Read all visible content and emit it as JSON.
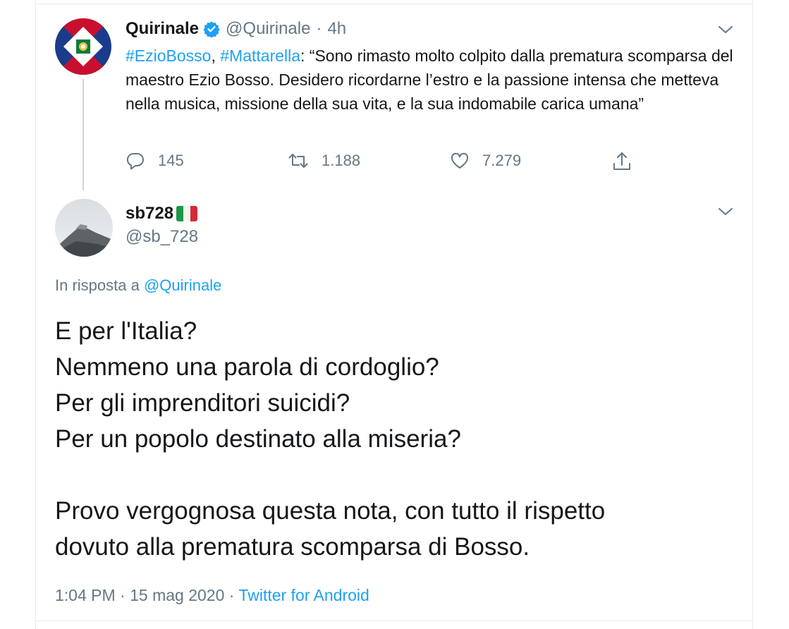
{
  "parent_tweet": {
    "author_name": "Quirinale",
    "handle": "@Quirinale",
    "separator": "·",
    "time": "4h",
    "hashtag_1": "#EzioBosso",
    "comma": ",",
    "hashtag_2": "#Mattarella",
    "text": ": “Sono rimasto molto colpito dalla prematura scomparsa del maestro Ezio Bosso. Desidero ricordarne l’estro e la passione intensa che metteva nella musica, missione della sua vita, e la sua indomabile carica umana”",
    "replies": "145",
    "retweets": "1.188",
    "likes": "7.279",
    "icons": {
      "reply": "reply-icon",
      "retweet": "retweet-icon",
      "like": "heart-icon",
      "share": "share-icon",
      "menu": "chevron-down-icon",
      "verified": "verified-badge-icon"
    }
  },
  "reply_tweet": {
    "author_name": "sb728",
    "flag": "italian-flag-icon",
    "handle": "@sb_728",
    "in_reply_to_prefix": "In risposta a",
    "in_reply_to_handle": "@Quirinale",
    "lines": [
      "E per l'Italia?",
      "Nemmeno una parola di cordoglio?",
      "Per gli imprenditori suicidi?",
      "Per un popolo destinato alla miseria?",
      "",
      "Provo vergognosa questa nota, con tutto il rispetto",
      "dovuto alla prematura scomparsa di Bosso."
    ],
    "time": "1:04 PM",
    "meta_sep": "·",
    "date": "15 mag 2020",
    "meta_sep_2": "·",
    "source": "Twitter for Android"
  },
  "colors": {
    "text": "#14171a",
    "secondary": "#657786",
    "accent": "#1da1f2",
    "border": "#e6ecf0"
  }
}
